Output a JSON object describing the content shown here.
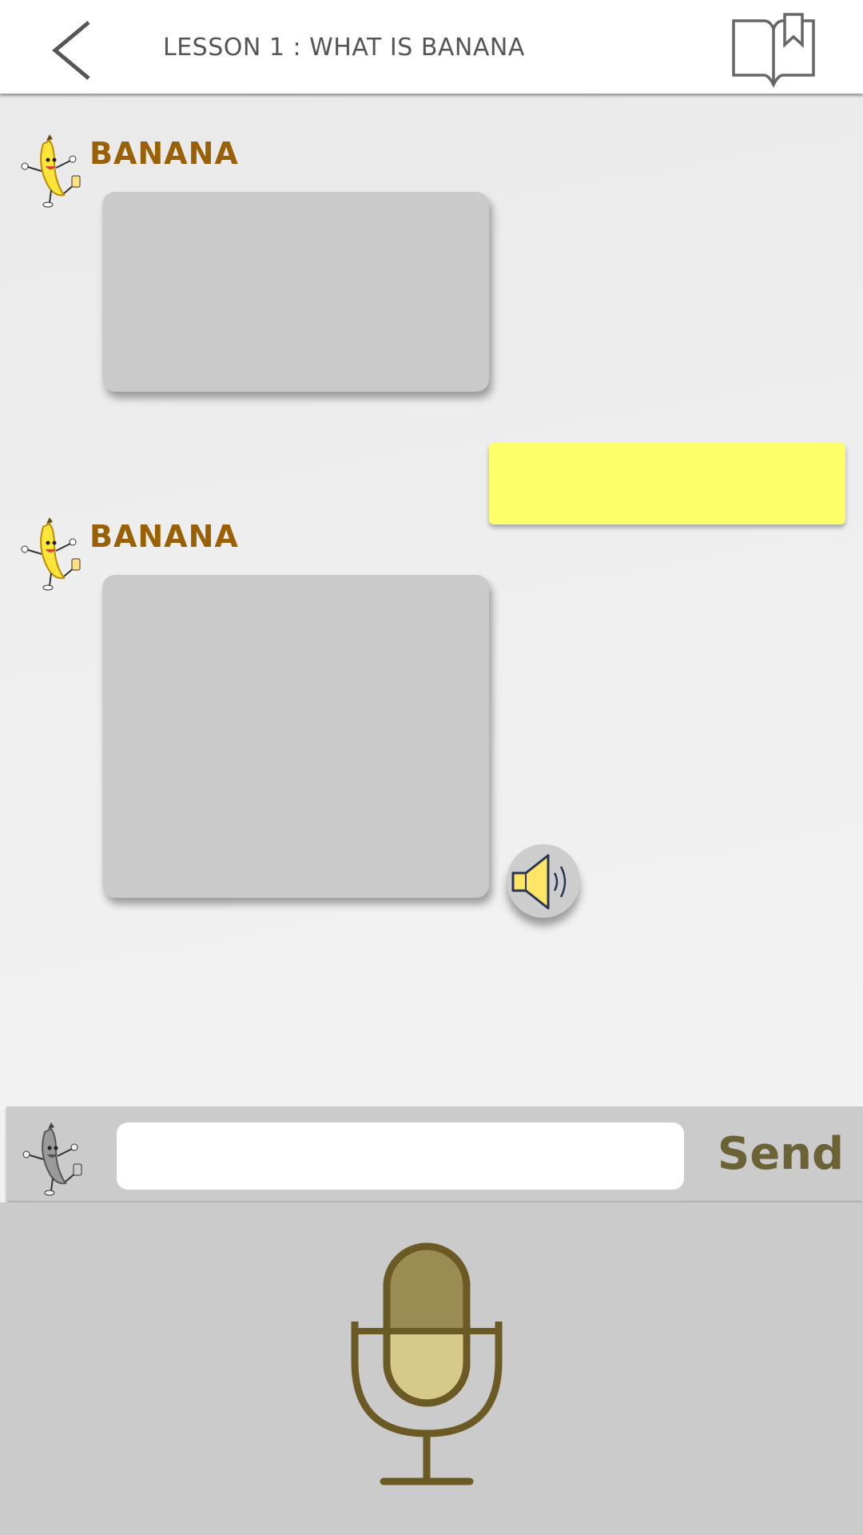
{
  "header": {
    "title": "LESSON 1 : WHAT IS BANANA",
    "back_icon": "chevron-left-icon",
    "book_icon": "book-bookmark-icon"
  },
  "messages": [
    {
      "sender": "BANANA",
      "type": "bot",
      "text": ""
    },
    {
      "sender": "",
      "type": "user",
      "text": ""
    },
    {
      "sender": "BANANA",
      "type": "bot",
      "text": "",
      "has_audio": true
    }
  ],
  "composer": {
    "input_value": "",
    "input_placeholder": "",
    "send_label": "Send"
  },
  "colors": {
    "sender_name": "#9a6005",
    "bot_bubble": "#cacaca",
    "user_bubble": "#ffff6a",
    "send_text": "#6b6235",
    "mic": "#6b5a24"
  }
}
